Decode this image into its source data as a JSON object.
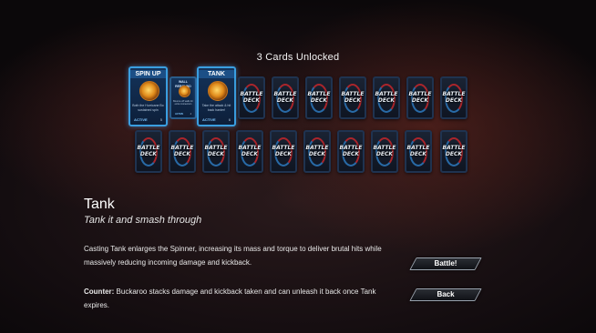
{
  "screen": {
    "unlocked_title": "3 Cards Unlocked"
  },
  "cards": {
    "back_label": "BATTLE DECK",
    "abilities": [
      {
        "name": "SPIN UP",
        "description": "Both the Hurricane Bo sustained spin",
        "status": "ACTIVE",
        "cost": "5"
      },
      {
        "name": "WALL REBOUND",
        "description": "Bounce off walls for extra momentum",
        "status": "ACTIVE",
        "cost": "4"
      },
      {
        "name": "TANK",
        "description": "Take the attack & hit back harder!",
        "status": "ACTIVE",
        "cost": "6"
      }
    ]
  },
  "detail": {
    "title": "Tank",
    "subtitle": "Tank it and smash through",
    "description": "Casting Tank enlarges the Spinner, increasing its mass and torque to deliver brutal hits while massively reducing incoming damage and kickback.",
    "counter_label": "Counter:",
    "counter_text": " Buckaroo stacks damage and kickback taken and can unleash it back once Tank expires."
  },
  "buttons": {
    "battle": "Battle!",
    "back": "Back"
  },
  "colors": {
    "card_border": "#1f3350",
    "ability_glow": "#3a9ee0",
    "swirl_red": "#b3262b",
    "swirl_blue": "#2a6fae"
  }
}
